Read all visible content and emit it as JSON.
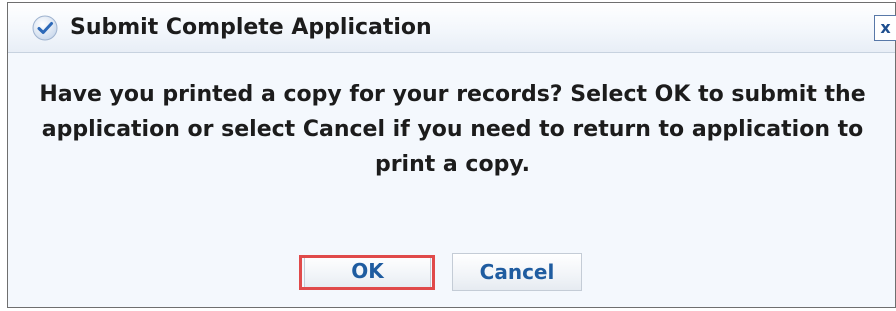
{
  "dialog": {
    "title": "Submit Complete Application",
    "title_icon": "check-circle-icon",
    "close_label": "x",
    "message": "Have you printed a copy for your records? Select OK to submit the application or select Cancel if you need to return to application to print a copy.",
    "ok_label": "OK",
    "cancel_label": "Cancel"
  },
  "colors": {
    "dialog_background": "#f4f8fd",
    "button_text": "#1f5ca0",
    "highlight_border": "#e04a4a",
    "title_icon": "#2d69b8"
  }
}
